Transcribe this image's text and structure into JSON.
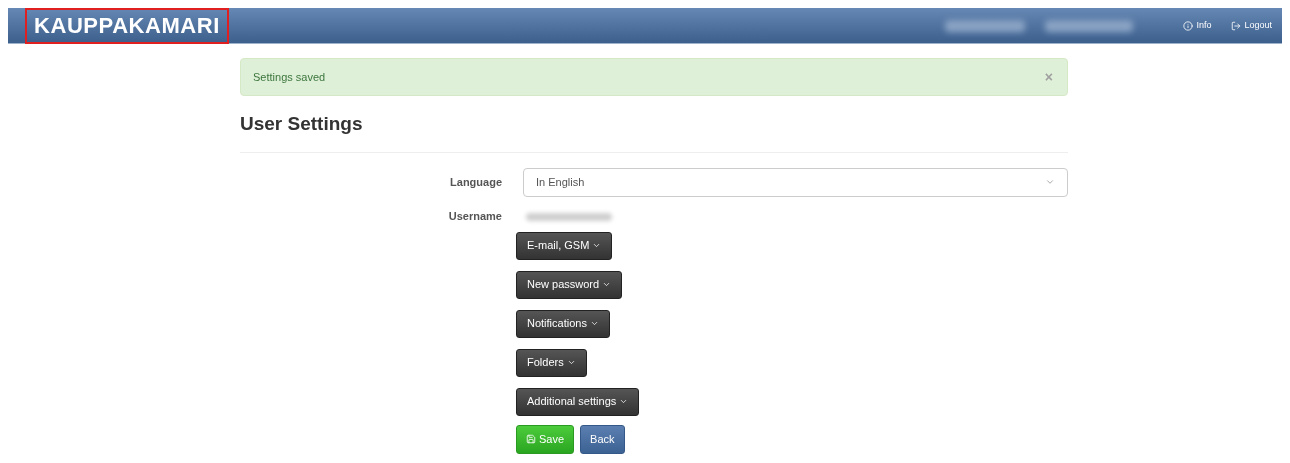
{
  "navbar": {
    "brand": "KAUPPAKAMARI",
    "links": [
      {
        "kind": "info",
        "label": "Info"
      },
      {
        "kind": "logout",
        "label": "Logout"
      }
    ]
  },
  "alert": {
    "message": "Settings saved",
    "close": "×"
  },
  "title": "User Settings",
  "form": {
    "language": {
      "label": "Language",
      "value": "In English"
    },
    "username": {
      "label": "Username"
    }
  },
  "sections": [
    {
      "label": "E-mail, GSM",
      "expanded": false
    },
    {
      "label": "New password",
      "expanded": false
    },
    {
      "label": "Notifications",
      "expanded": false
    },
    {
      "label": "Folders",
      "expanded": false
    },
    {
      "label": "Additional settings",
      "expanded": false
    }
  ],
  "actions": [
    {
      "kind": "save",
      "label": "Save"
    },
    {
      "kind": "back",
      "label": "Back"
    }
  ]
}
